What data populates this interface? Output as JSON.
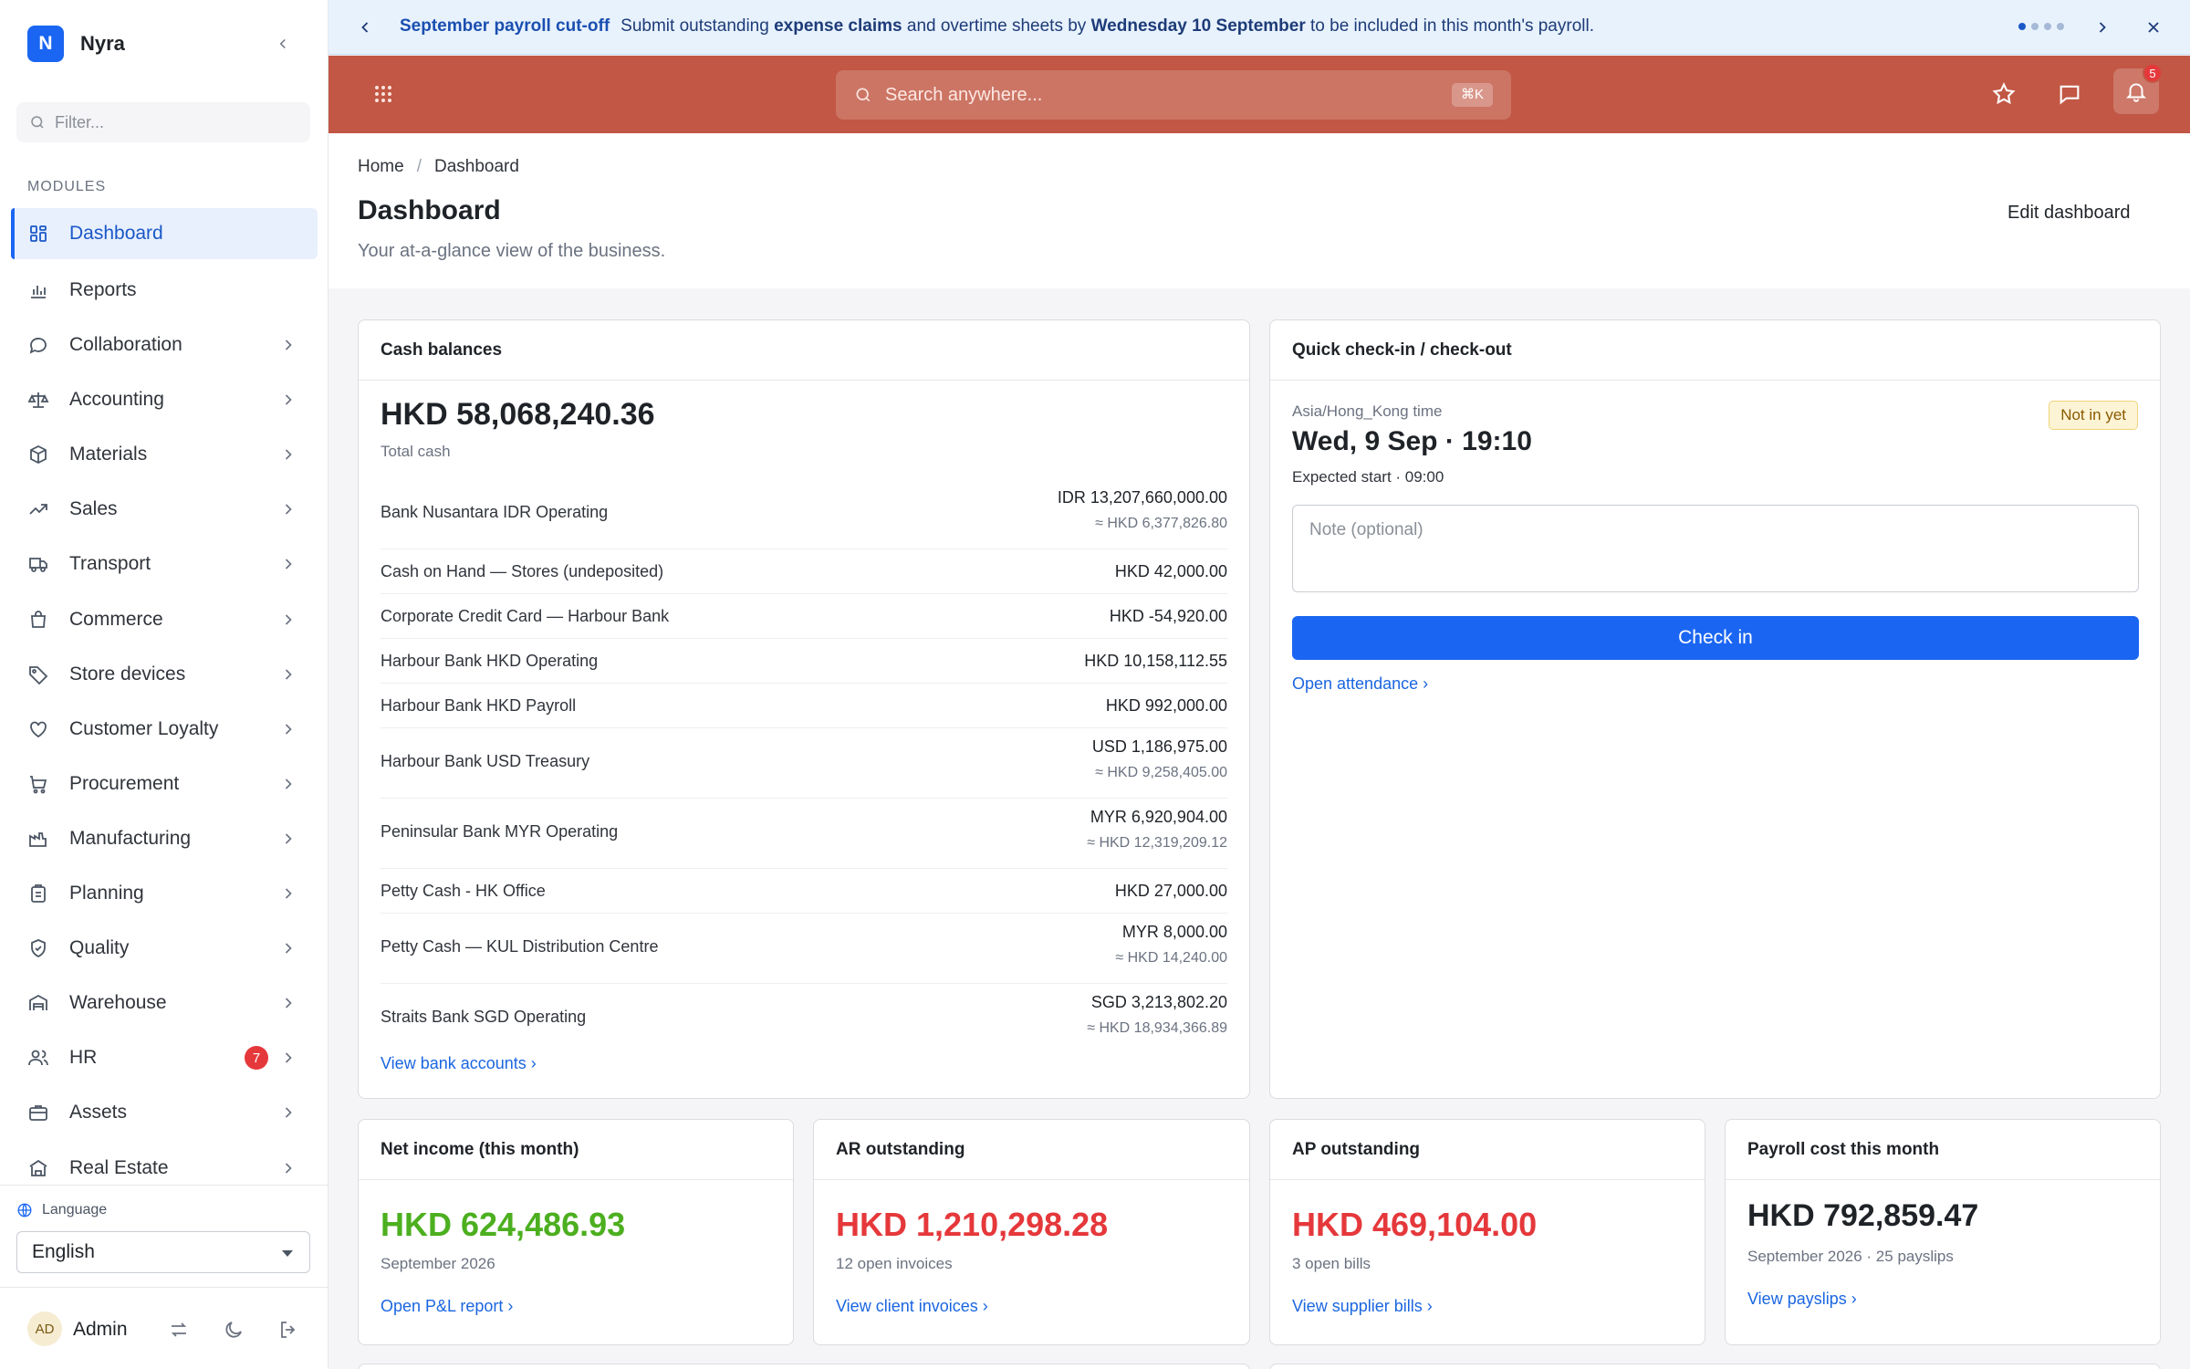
{
  "brand": {
    "logo_letter": "N",
    "name": "Nyra"
  },
  "sidebar": {
    "filter_placeholder": "Filter...",
    "section_label": "MODULES",
    "items": [
      {
        "label": "Dashboard",
        "icon": "grid-icon"
      },
      {
        "label": "Reports",
        "icon": "bar-chart-icon"
      },
      {
        "label": "Collaboration",
        "icon": "chat-icon"
      },
      {
        "label": "Accounting",
        "icon": "scale-icon"
      },
      {
        "label": "Materials",
        "icon": "box-icon"
      },
      {
        "label": "Sales",
        "icon": "trend-up-icon"
      },
      {
        "label": "Transport",
        "icon": "truck-icon"
      },
      {
        "label": "Commerce",
        "icon": "bag-icon"
      },
      {
        "label": "Store devices",
        "icon": "tag-icon"
      },
      {
        "label": "Customer Loyalty",
        "icon": "heart-icon"
      },
      {
        "label": "Procurement",
        "icon": "cart-icon"
      },
      {
        "label": "Manufacturing",
        "icon": "factory-icon"
      },
      {
        "label": "Planning",
        "icon": "clipboard-icon"
      },
      {
        "label": "Quality",
        "icon": "shield-check-icon"
      },
      {
        "label": "Warehouse",
        "icon": "warehouse-icon"
      },
      {
        "label": "HR",
        "icon": "users-icon",
        "badge": "7"
      },
      {
        "label": "Assets",
        "icon": "briefcase-icon"
      },
      {
        "label": "Real Estate",
        "icon": "building-icon"
      }
    ],
    "language_label": "Language",
    "language_value": "English",
    "user_initials": "AD",
    "user_name": "Admin"
  },
  "banner": {
    "title": "September payroll cut-off",
    "text_1": "Submit outstanding ",
    "bold_1": "expense claims",
    "text_2": " and overtime sheets by ",
    "bold_2": "Wednesday 10 September",
    "text_3": " to be included in this month's payroll."
  },
  "topbar": {
    "search_placeholder": "Search anywhere...",
    "shortcut": "⌘K",
    "notification_count": "5"
  },
  "header": {
    "breadcrumb_home": "Home",
    "breadcrumb_current": "Dashboard",
    "title": "Dashboard",
    "subtitle": "Your at-a-glance view of the business.",
    "edit_label": "Edit dashboard"
  },
  "cash": {
    "title": "Cash balances",
    "total": "HKD 58,068,240.36",
    "total_label": "Total cash",
    "accounts": [
      {
        "name": "Bank Nusantara IDR Operating",
        "amount": "IDR 13,207,660,000.00",
        "converted": "≈ HKD 6,377,826.80"
      },
      {
        "name": "Cash on Hand — Stores (undeposited)",
        "amount": "HKD 42,000.00",
        "converted": ""
      },
      {
        "name": "Corporate Credit Card — Harbour Bank",
        "amount": "HKD -54,920.00",
        "converted": ""
      },
      {
        "name": "Harbour Bank HKD Operating",
        "amount": "HKD 10,158,112.55",
        "converted": ""
      },
      {
        "name": "Harbour Bank HKD Payroll",
        "amount": "HKD 992,000.00",
        "converted": ""
      },
      {
        "name": "Harbour Bank USD Treasury",
        "amount": "USD 1,186,975.00",
        "converted": "≈ HKD 9,258,405.00"
      },
      {
        "name": "Peninsular Bank MYR Operating",
        "amount": "MYR 6,920,904.00",
        "converted": "≈ HKD 12,319,209.12"
      },
      {
        "name": "Petty Cash - HK Office",
        "amount": "HKD 27,000.00",
        "converted": ""
      },
      {
        "name": "Petty Cash — KUL Distribution Centre",
        "amount": "MYR 8,000.00",
        "converted": "≈ HKD 14,240.00"
      },
      {
        "name": "Straits Bank SGD Operating",
        "amount": "SGD 3,213,802.20",
        "converted": "≈ HKD 18,934,366.89"
      }
    ],
    "link": "View bank accounts ›"
  },
  "checkin": {
    "title": "Quick check-in / check-out",
    "timezone": "Asia/Hong_Kong time",
    "datetime": "Wed, 9 Sep · 19:10",
    "expected": "Expected start · 09:00",
    "status": "Not in yet",
    "note_placeholder": "Note (optional)",
    "button": "Check in",
    "link": "Open attendance ›"
  },
  "stats": [
    {
      "title": "Net income (this month)",
      "value": "HKD 624,486.93",
      "sub": "September 2026",
      "link": "Open P&L report ›"
    },
    {
      "title": "AR outstanding",
      "value": "HKD 1,210,298.28",
      "sub": "12 open invoices",
      "link": "View client invoices ›"
    },
    {
      "title": "AP outstanding",
      "value": "HKD 469,104.00",
      "sub": "3 open bills",
      "link": "View supplier bills ›"
    },
    {
      "title": "Payroll cost this month",
      "value": "HKD 792,859.47",
      "sub": "September 2026 · 25 payslips",
      "link": "View payslips ›"
    }
  ],
  "colors": {
    "accent": "#1a66f2",
    "topbar": "#c15744",
    "positive": "#4caf1f",
    "negative": "#e5383b"
  }
}
